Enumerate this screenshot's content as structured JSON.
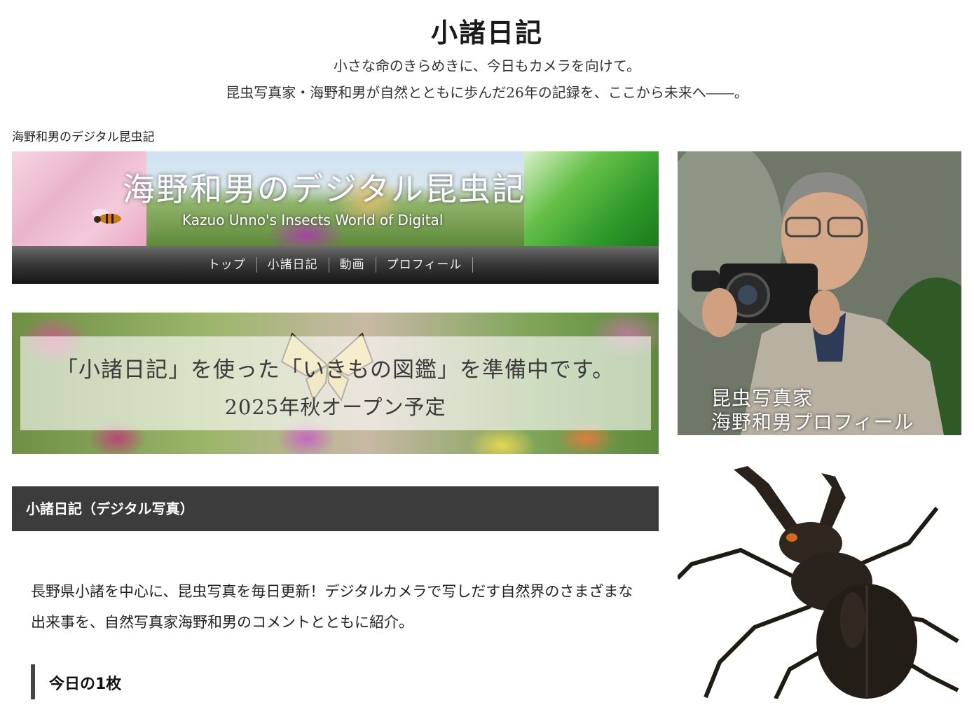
{
  "header": {
    "title": "小諸日記",
    "tagline_line1": "小さな命のきらめきに、今日もカメラを向けて。",
    "tagline_line2": "昆虫写真家・海野和男が自然とともに歩んだ26年の記録を、ここから未来へ――。"
  },
  "breadcrumb": "海野和男のデジタル昆虫記",
  "banner": {
    "title": "海野和男のデジタル昆虫記",
    "subtitle": "Kazuo Unno's Insects World of Digital",
    "nav": [
      "トップ",
      "小諸日記",
      "動画",
      "プロフィール"
    ]
  },
  "zukan": {
    "line1": "「小諸日記」を使った「いきもの図鑑」を準備中です。",
    "line2": "2025年秋オープン予定"
  },
  "section": {
    "title": "小諸日記（デジタル写真）",
    "intro": "長野県小諸を中心に、昆虫写真を毎日更新！デジタルカメラで写しだす自然界のさまざまな出来事を、自然写真家海野和男のコメントとともに紹介。",
    "subheading": "今日の1枚"
  },
  "profile": {
    "line1": "昆虫写真家",
    "line2": "海野和男プロフィール"
  },
  "icons": {
    "bee": "bee-icon",
    "photographer": "photographer-photo",
    "beetle": "stag-beetle-photo"
  }
}
